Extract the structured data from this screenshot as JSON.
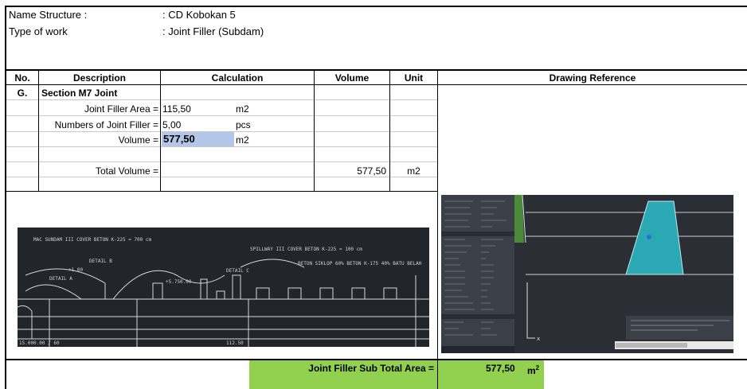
{
  "info": {
    "name_label": "Name Structure :",
    "name_value": ": CD Kobokan 5",
    "work_label": "Type of work",
    "work_value": ": Joint Filler (Subdam)"
  },
  "table": {
    "headers": {
      "no": "No.",
      "description": "Description",
      "calculation": "Calculation",
      "volume": "Volume",
      "unit": "Unit",
      "reference": "Drawing Reference"
    },
    "section_no": "G.",
    "section_title": "Section M7 Joint",
    "rows": [
      {
        "label": "Joint Filler Area =",
        "value": "115,50",
        "unit": "m2"
      },
      {
        "label": "Numbers of Joint Filler =",
        "value": "5,00",
        "unit": "pcs"
      },
      {
        "label": "Volume =",
        "value": "577,50",
        "unit": "m2"
      }
    ],
    "total_label": "Total Volume =",
    "total_volume": "577,50",
    "total_unit": "m2"
  },
  "drawing": {
    "label_top": "MAC SUNDAM III COVER BETON K-225 = 700 cm",
    "label_mid": "SPILLWAY III COVER BETON K-225 = 100 cm",
    "label_right": "BETON SIKLOP 60% BETON K-175 40% BATU BELAH",
    "detail_b": "DETAIL B",
    "detail_a": "DETAIL A",
    "detail_c": "DETAIL C",
    "dim_1": "+1.00",
    "dim_2": "+5.750.00",
    "bottom_left": "15.000.00 / 60",
    "bottom_mid": "112.50"
  },
  "summary": {
    "label": "Joint Filler Sub Total Area =",
    "value": "577,50",
    "unit": "m",
    "unit_sup": "2"
  },
  "colors": {
    "selected_cell": "#b4c6e7",
    "summary_fill": "#92d050",
    "cad_fill": "#2aa9b5"
  }
}
